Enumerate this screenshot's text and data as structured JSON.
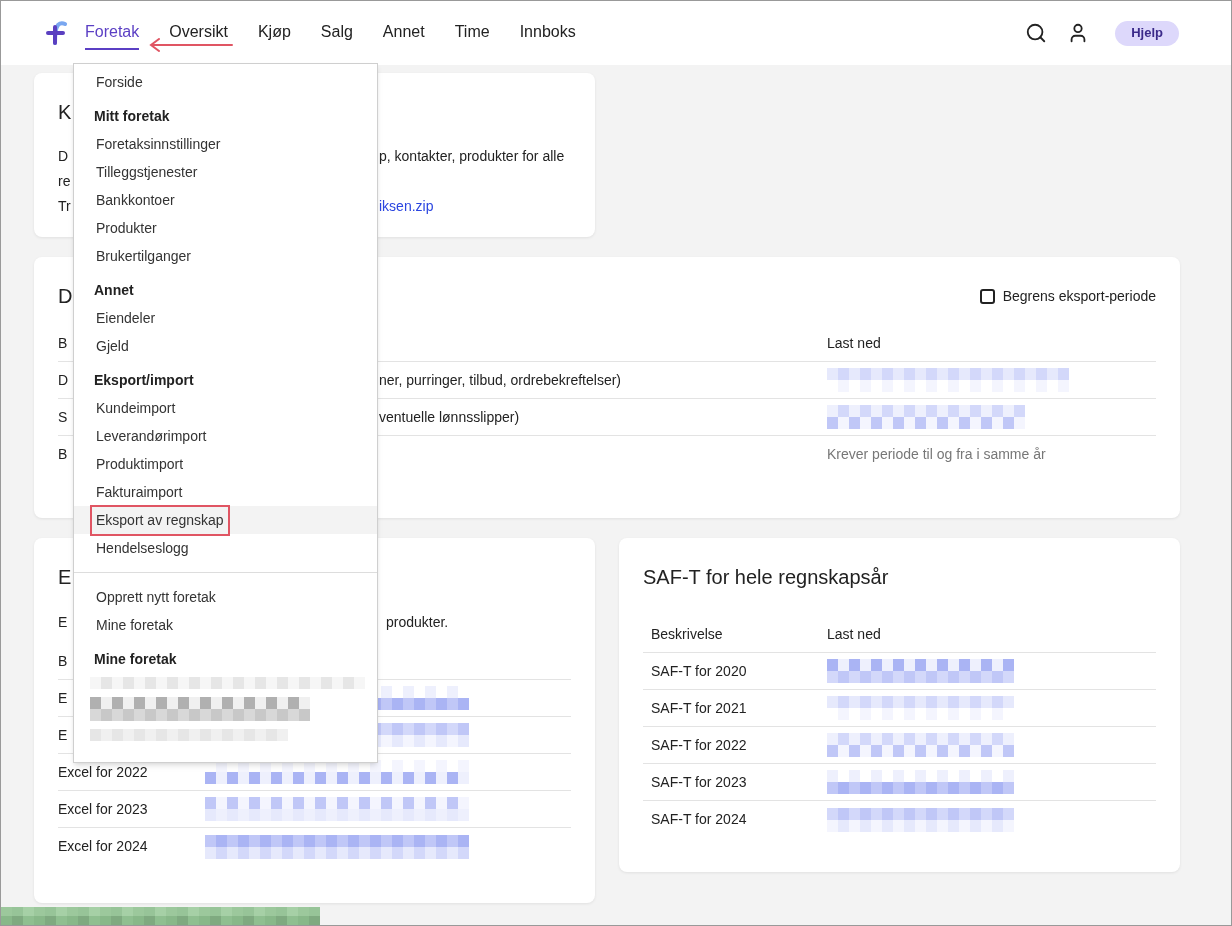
{
  "nav": {
    "items": [
      {
        "label": "Foretak",
        "selected": true
      },
      {
        "label": "Oversikt",
        "selected": false
      },
      {
        "label": "Kjøp",
        "selected": false
      },
      {
        "label": "Salg",
        "selected": false
      },
      {
        "label": "Annet",
        "selected": false
      },
      {
        "label": "Time",
        "selected": false
      },
      {
        "label": "Innboks",
        "selected": false
      }
    ],
    "help_button": "Hjelp"
  },
  "menu": {
    "groups": [
      {
        "items": [
          {
            "kind": "link",
            "label": "Forside",
            "selected": false,
            "annotated": false
          }
        ]
      },
      {
        "heading": "Mitt foretak",
        "items": [
          {
            "kind": "link",
            "label": "Foretaksinnstillinger",
            "selected": false,
            "annotated": false
          },
          {
            "kind": "link",
            "label": "Tilleggstjenester",
            "selected": false,
            "annotated": false
          },
          {
            "kind": "link",
            "label": "Bankkontoer",
            "selected": false,
            "annotated": false
          },
          {
            "kind": "link",
            "label": "Produkter",
            "selected": false,
            "annotated": false
          },
          {
            "kind": "link",
            "label": "Brukertilganger",
            "selected": false,
            "annotated": false
          }
        ]
      },
      {
        "heading": "Annet",
        "items": [
          {
            "kind": "link",
            "label": "Eiendeler",
            "selected": false,
            "annotated": false
          },
          {
            "kind": "link",
            "label": "Gjeld",
            "selected": false,
            "annotated": false
          }
        ]
      },
      {
        "heading": "Eksport/import",
        "items": [
          {
            "kind": "link",
            "label": "Kundeimport",
            "selected": false,
            "annotated": false
          },
          {
            "kind": "link",
            "label": "Leverandørimport",
            "selected": false,
            "annotated": false
          },
          {
            "kind": "link",
            "label": "Produktimport",
            "selected": false,
            "annotated": false
          },
          {
            "kind": "link",
            "label": "Fakturaimport",
            "selected": false,
            "annotated": false
          },
          {
            "kind": "link",
            "label": "Eksport av regnskap",
            "selected": true,
            "annotated": true
          },
          {
            "kind": "link",
            "label": "Hendelseslogg",
            "selected": false,
            "annotated": false
          }
        ]
      },
      {
        "separated": true,
        "items": [
          {
            "kind": "link",
            "label": "Opprett nytt foretak",
            "selected": false,
            "annotated": false
          },
          {
            "kind": "link",
            "label": "Mine foretak",
            "selected": false,
            "annotated": false
          }
        ]
      },
      {
        "heading": "Mine foretak",
        "items": [
          {
            "kind": "redacted"
          },
          {
            "kind": "redacted"
          },
          {
            "kind": "redacted"
          }
        ]
      }
    ]
  },
  "card_1": {
    "title": "K",
    "lines": [
      {
        "left": "D",
        "right": "p, kontakter, produkter for alle"
      },
      {
        "left": "re"
      },
      {
        "left": "Tr",
        "link": "iksen.zip"
      }
    ]
  },
  "card_2": {
    "title": "D",
    "checkbox": {
      "label": "Begrens eksport-periode",
      "checked": false
    },
    "columns": [
      {
        "left": "B",
        "right": "Last ned"
      }
    ],
    "rows": [
      {
        "column_1": "D",
        "column_2": "ner, purringer, tilbud, ordrebekreftelser)",
        "download": {
          "kind": "redacted"
        }
      },
      {
        "column_1": "S",
        "column_2": "ventuelle lønnsslipper)",
        "download": {
          "kind": "redacted"
        }
      },
      {
        "column_1": "B",
        "download": {
          "kind": "note",
          "text": "Krever periode til og fra i samme år"
        }
      }
    ]
  },
  "card_3": {
    "title": "E",
    "intro": {
      "left": "E",
      "right": "produkter."
    },
    "header": "B",
    "rows": [
      {
        "label": "E"
      },
      {
        "label": "E"
      },
      {
        "label": "Excel for 2022"
      },
      {
        "label": "Excel for 2023"
      },
      {
        "label": "Excel for 2024"
      }
    ]
  },
  "card_4": {
    "title": "SAF-T for hele regnskapsår",
    "columns": [
      "Beskrivelse",
      "Last ned"
    ],
    "rows": [
      {
        "label": "SAF-T for 2020"
      },
      {
        "label": "SAF-T for 2021"
      },
      {
        "label": "SAF-T for 2022"
      },
      {
        "label": "SAF-T for 2023"
      },
      {
        "label": "SAF-T for 2024"
      }
    ]
  }
}
